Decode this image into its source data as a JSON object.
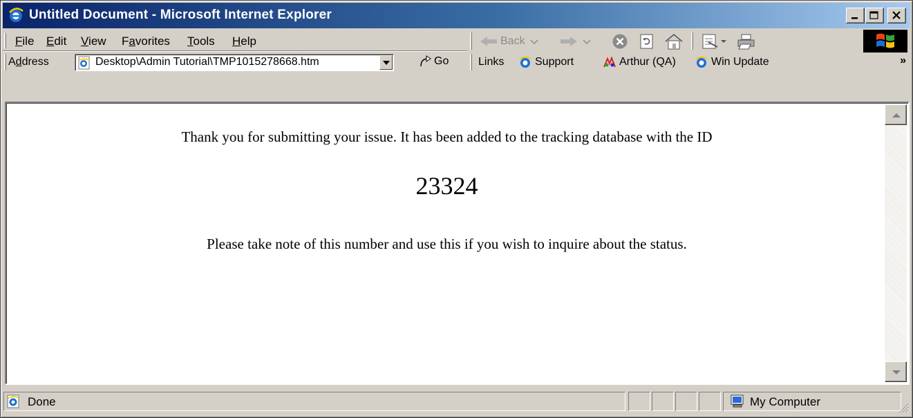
{
  "window": {
    "title": "Untitled Document - Microsoft Internet Explorer"
  },
  "menu": {
    "items": [
      {
        "label": "File",
        "accel": "F",
        "rest": "ile"
      },
      {
        "label": "Edit",
        "accel": "E",
        "rest": "dit"
      },
      {
        "label": "View",
        "accel": "V",
        "rest": "iew"
      },
      {
        "label": "Favorites",
        "pre": "F",
        "accel": "a",
        "rest": "vorites"
      },
      {
        "label": "Tools",
        "accel": "T",
        "rest": "ools"
      },
      {
        "label": "Help",
        "accel": "H",
        "rest": "elp"
      }
    ]
  },
  "toolbar": {
    "back_label": "Back"
  },
  "address": {
    "label_pre": "A",
    "label_accel": "d",
    "label_rest": "dress",
    "value": "Desktop\\Admin Tutorial\\TMP1015278668.htm",
    "go_label": "Go"
  },
  "links": {
    "label": "Links",
    "items": [
      "Support",
      "Arthur (QA)",
      "Win Update"
    ],
    "more": "»"
  },
  "page": {
    "message": "Thank you for submitting your issue. It has been added to the tracking database with the ID",
    "issue_id": "23324",
    "note": "Please take note of this number and use this if you wish to inquire about the status."
  },
  "status": {
    "text": "Done",
    "zone": "My Computer"
  },
  "colors": {
    "titlebar_start": "#0a246a",
    "titlebar_end": "#a6caf0",
    "chrome": "#d4d0c8"
  }
}
